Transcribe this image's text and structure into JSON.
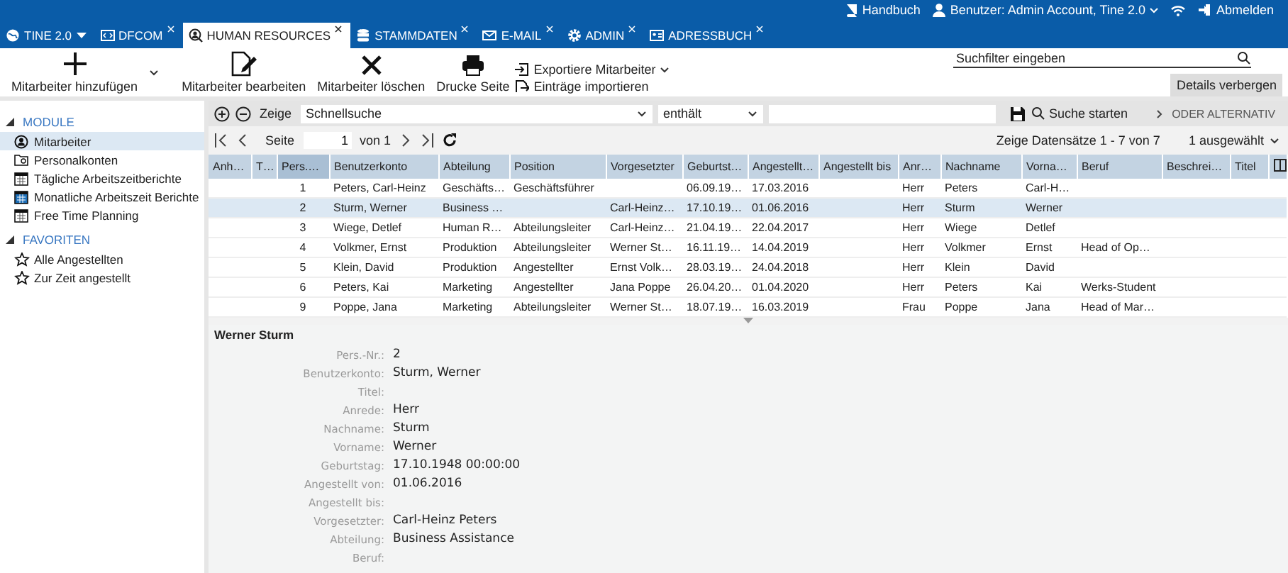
{
  "header_links": [
    {
      "kind": "manual",
      "label": "Handbuch"
    },
    {
      "kind": "user",
      "label": "Benutzer: Admin Account, Tine 2.0"
    },
    {
      "kind": "logout",
      "label": "Abmelden"
    }
  ],
  "tabs": [
    {
      "kind": "main",
      "label": "TINE 2.0",
      "selected": false,
      "closable": false
    },
    {
      "kind": "code",
      "label": "DFCOM",
      "selected": false,
      "closable": true
    },
    {
      "kind": "hr",
      "label": "HUMAN RESOURCES",
      "selected": true,
      "closable": true
    },
    {
      "kind": "db",
      "label": "STAMMDATEN",
      "selected": false,
      "closable": true
    },
    {
      "kind": "mail",
      "label": "E-MAIL",
      "selected": false,
      "closable": true
    },
    {
      "kind": "gear",
      "label": "ADMIN",
      "selected": false,
      "closable": true
    },
    {
      "kind": "card",
      "label": "ADRESSBUCH",
      "selected": false,
      "closable": true
    }
  ],
  "toolbar": {
    "add": "Mitarbeiter hinzufügen",
    "edit": "Mitarbeiter bearbeiten",
    "delete": "Mitarbeiter löschen",
    "print": "Drucke Seite",
    "export": "Exportiere Mitarbeiter",
    "import": "Einträge importieren",
    "search": {
      "placeholder": "Suchfilter eingeben"
    },
    "details": "Details verbergen"
  },
  "sidebar": [
    {
      "title": "MODULE",
      "expanded": true,
      "items": [
        {
          "kind": "person",
          "label": "Mitarbeiter",
          "selected": true
        },
        {
          "kind": "folder",
          "label": "Personalkonten",
          "selected": false
        },
        {
          "kind": "calendar",
          "label": "Tägliche Arbeitszeitberichte",
          "selected": false
        },
        {
          "kind": "calendar-filled",
          "label": "Monatliche Arbeitszeit Berichte",
          "selected": false
        },
        {
          "kind": "calendar",
          "label": "Free Time Planning",
          "selected": false
        }
      ]
    },
    {
      "title": "FAVORITEN",
      "expanded": true,
      "items": [
        {
          "kind": "star",
          "label": "Alle Angestellten",
          "selected": false
        },
        {
          "kind": "star",
          "label": "Zur Zeit angestellt",
          "selected": false
        }
      ]
    }
  ],
  "filter": {
    "label": "Zeige",
    "field": "Schnellsuche",
    "operator": "enthält",
    "search": "Suche starten",
    "alternative": "ODER ALTERNATIV"
  },
  "paging": {
    "page_label": "Seite",
    "page": "1",
    "of": "von 1",
    "summary": "Zeige Datensätze 1 - 7 von 7",
    "selection": "1 ausgewählt"
  },
  "table": {
    "columns": [
      "Anh…",
      "T…",
      "Pers.…",
      "Benutzerkonto",
      "Abteilung",
      "Position",
      "Vorgesetzter",
      "Geburtst…",
      "Angestellt…",
      "Angestellt bis",
      "Anr…",
      "Nachname",
      "Vorna…",
      "Beruf",
      "Beschrei…",
      "Titel"
    ],
    "rows": [
      {
        "selected": false,
        "cells": [
          "",
          "",
          "1",
          "Peters, Carl-Heinz",
          "Geschäfts…",
          "Geschäftsführer",
          "",
          "06.09.19…",
          "17.03.2016",
          "",
          "Herr",
          "Peters",
          "Carl-H…",
          "",
          "",
          ""
        ]
      },
      {
        "selected": true,
        "cells": [
          "",
          "",
          "2",
          "Sturm, Werner",
          "Business …",
          "",
          "Carl-Heinz…",
          "17.10.19…",
          "01.06.2016",
          "",
          "Herr",
          "Sturm",
          "Werner",
          "",
          "",
          ""
        ]
      },
      {
        "selected": false,
        "cells": [
          "",
          "",
          "3",
          "Wiege, Detlef",
          "Human R…",
          "Abteilungsleiter",
          "Carl-Heinz…",
          "21.04.19…",
          "22.04.2017",
          "",
          "Herr",
          "Wiege",
          "Detlef",
          "",
          "",
          ""
        ]
      },
      {
        "selected": false,
        "cells": [
          "",
          "",
          "4",
          "Volkmer, Ernst",
          "Produktion",
          "Abteilungsleiter",
          "Werner St…",
          "16.11.19…",
          "14.04.2019",
          "",
          "Herr",
          "Volkmer",
          "Ernst",
          "Head of Op…",
          "",
          ""
        ]
      },
      {
        "selected": false,
        "cells": [
          "",
          "",
          "5",
          "Klein, David",
          "Produktion",
          "Angestellter",
          "Ernst Volk…",
          "28.03.19…",
          "24.04.2018",
          "",
          "Herr",
          "Klein",
          "David",
          "",
          "",
          ""
        ]
      },
      {
        "selected": false,
        "cells": [
          "",
          "",
          "6",
          "Peters, Kai",
          "Marketing",
          "Angestellter",
          "Jana Poppe",
          "26.04.20…",
          "01.04.2020",
          "",
          "Herr",
          "Peters",
          "Kai",
          "Werks-Student",
          "",
          ""
        ]
      },
      {
        "selected": false,
        "cells": [
          "",
          "",
          "9",
          "Poppe, Jana",
          "Marketing",
          "Abteilungsleiter",
          "Werner St…",
          "18.07.19…",
          "16.03.2019",
          "",
          "Frau",
          "Poppe",
          "Jana",
          "Head of Mar…",
          "",
          ""
        ]
      }
    ]
  },
  "details": {
    "title": "Werner Sturm",
    "fields": [
      {
        "label": "Pers.-Nr.:",
        "value": "2"
      },
      {
        "label": "Benutzerkonto:",
        "value": "Sturm, Werner"
      },
      {
        "label": "Titel:"
      },
      {
        "label": "Anrede:",
        "value": "Herr"
      },
      {
        "label": "Nachname:",
        "value": "Sturm"
      },
      {
        "label": "Vorname:",
        "value": "Werner"
      },
      {
        "label": "Geburtstag:",
        "value": "17.10.1948 00:00:00"
      },
      {
        "label": "Angestellt von:",
        "value": "01.06.2016"
      },
      {
        "label": "Angestellt bis:"
      },
      {
        "label": "Vorgesetzter:",
        "value": "Carl-Heinz Peters"
      },
      {
        "label": "Abteilung:",
        "value": "Business Assistance"
      },
      {
        "label": "Beruf:"
      }
    ]
  }
}
